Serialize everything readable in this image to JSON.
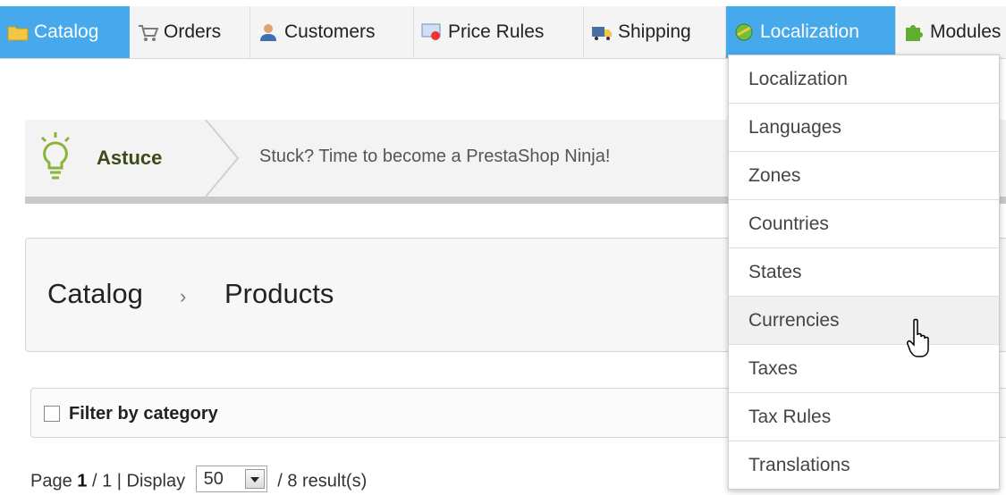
{
  "nav": {
    "items": [
      {
        "label": "Catalog",
        "icon": "folder-icon"
      },
      {
        "label": "Orders",
        "icon": "cart-icon"
      },
      {
        "label": "Customers",
        "icon": "user-icon"
      },
      {
        "label": "Price Rules",
        "icon": "price-tag-icon"
      },
      {
        "label": "Shipping",
        "icon": "truck-icon"
      },
      {
        "label": "Localization",
        "icon": "globe-icon"
      },
      {
        "label": "Modules",
        "icon": "puzzle-icon"
      }
    ],
    "active_color": "#45a9ec"
  },
  "tip": {
    "title": "Astuce",
    "text": "Stuck? Time to become a PrestaShop Ninja!"
  },
  "breadcrumb": {
    "section": "Catalog",
    "page": "Products"
  },
  "filter": {
    "label": "Filter by category"
  },
  "pagination": {
    "page_prefix": "Page",
    "current_page": "1",
    "total_pages": "/ 1 | Display",
    "display_value": "50",
    "results": "/ 8 result(s)"
  },
  "dropdown": {
    "items": [
      "Localization",
      "Languages",
      "Zones",
      "Countries",
      "States",
      "Currencies",
      "Taxes",
      "Tax Rules",
      "Translations"
    ],
    "hovered": "Currencies"
  }
}
